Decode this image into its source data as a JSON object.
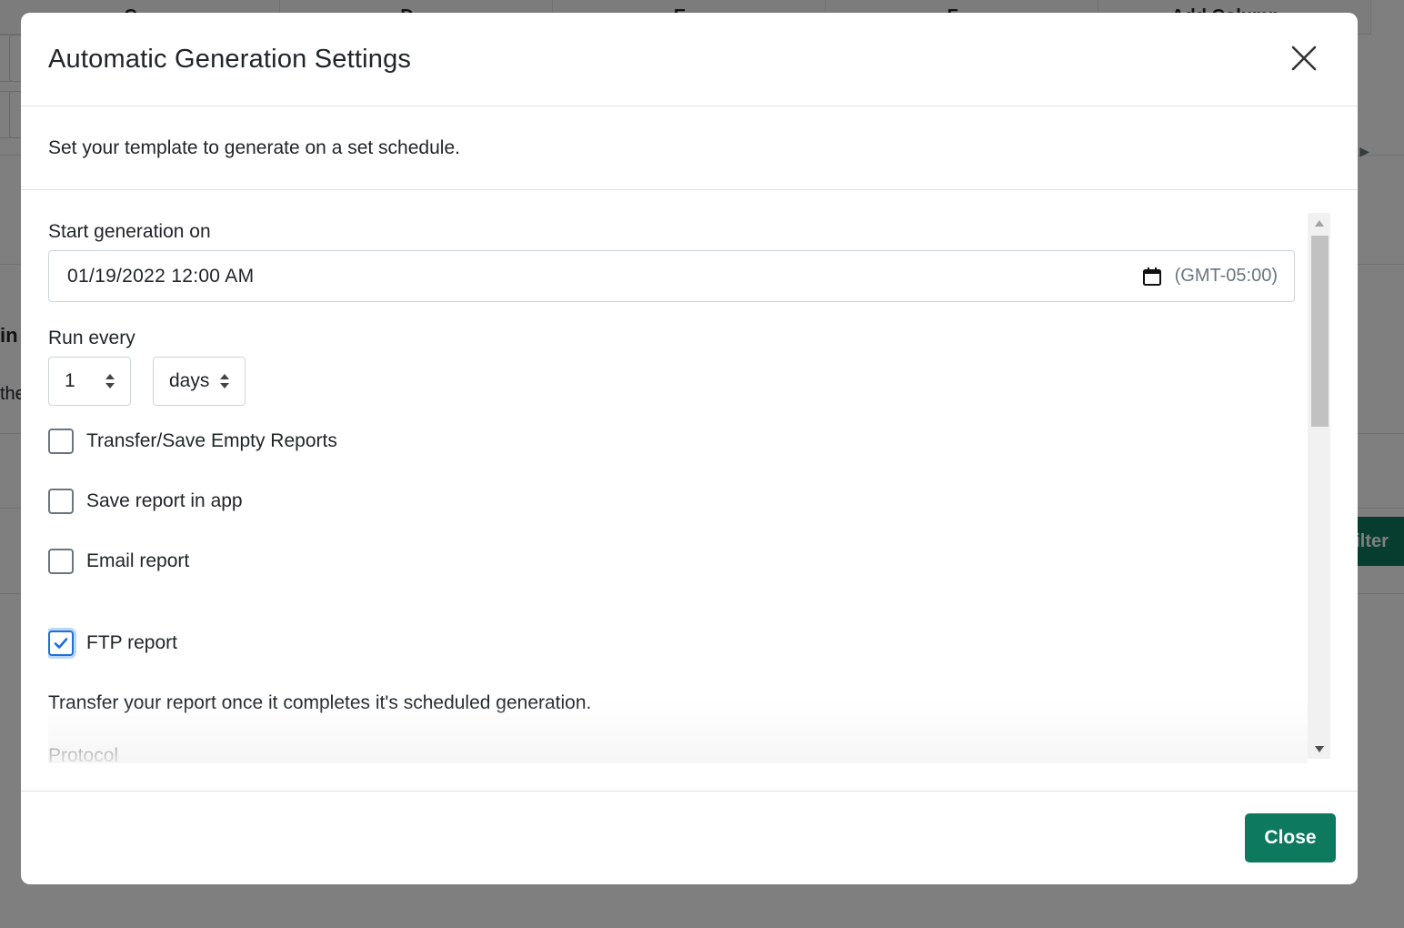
{
  "background": {
    "column_headers": [
      "C",
      "D",
      "E",
      "F",
      "Add Column"
    ],
    "partial_text_bold": "in",
    "partial_text": "the",
    "filter_button_fragment": "Filter"
  },
  "modal": {
    "title": "Automatic Generation Settings",
    "description": "Set your template to generate on a set schedule.",
    "start_generation": {
      "label": "Start generation on",
      "value": "01/19/2022  12:00  AM",
      "timezone": "(GMT-05:00)"
    },
    "run_every": {
      "label": "Run every",
      "interval_value": "1",
      "interval_unit": "days"
    },
    "options": [
      {
        "label": "Transfer/Save Empty Reports",
        "checked": false
      },
      {
        "label": "Save report in app",
        "checked": false
      },
      {
        "label": "Email report",
        "checked": false
      },
      {
        "label": "FTP report",
        "checked": true
      }
    ],
    "ftp_description": "Transfer your report once it completes it's scheduled generation.",
    "protocol_label": "Protocol",
    "close_button": "Close"
  },
  "colors": {
    "primary_green": "#0d7a5f",
    "checkbox_blue": "#1f6fd6",
    "backdrop": "rgba(0,0,0,0.5)"
  }
}
